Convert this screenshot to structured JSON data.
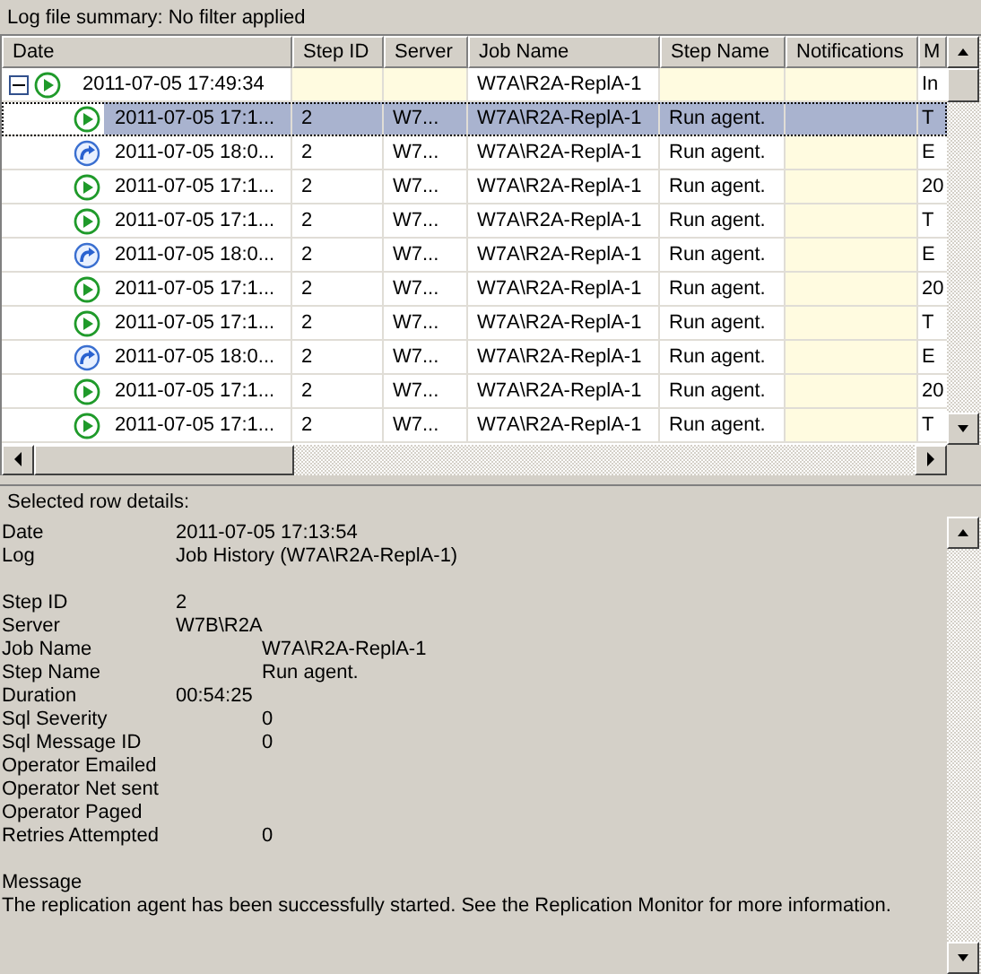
{
  "summary_label": "Log file summary: No filter applied",
  "grid": {
    "columns": [
      "Date",
      "Step ID",
      "Server",
      "Job Name",
      "Step Name",
      "Notifications",
      "M"
    ],
    "rows": [
      {
        "kind": "play",
        "date": "2011-07-05 17:49:34",
        "job_name": "W7A\\R2A-ReplA-1",
        "message": "In",
        "expanded": true,
        "selected": false,
        "children": [
          {
            "kind": "play",
            "date": "2011-07-05 17:1...",
            "step_id": "2",
            "server": "W7...",
            "job_name": "W7A\\R2A-ReplA-1",
            "step_name": "Run agent.",
            "message": "T",
            "selected": true
          },
          {
            "kind": "retry",
            "date": "2011-07-05 18:0...",
            "step_id": "2",
            "server": "W7...",
            "job_name": "W7A\\R2A-ReplA-1",
            "step_name": "Run agent.",
            "message": "E",
            "selected": false
          },
          {
            "kind": "play",
            "date": "2011-07-05 17:1...",
            "step_id": "2",
            "server": "W7...",
            "job_name": "W7A\\R2A-ReplA-1",
            "step_name": "Run agent.",
            "message": "20",
            "selected": false
          },
          {
            "kind": "play",
            "date": "2011-07-05 17:1...",
            "step_id": "2",
            "server": "W7...",
            "job_name": "W7A\\R2A-ReplA-1",
            "step_name": "Run agent.",
            "message": "T",
            "selected": false
          },
          {
            "kind": "retry",
            "date": "2011-07-05 18:0...",
            "step_id": "2",
            "server": "W7...",
            "job_name": "W7A\\R2A-ReplA-1",
            "step_name": "Run agent.",
            "message": "E",
            "selected": false
          },
          {
            "kind": "play",
            "date": "2011-07-05 17:1...",
            "step_id": "2",
            "server": "W7...",
            "job_name": "W7A\\R2A-ReplA-1",
            "step_name": "Run agent.",
            "message": "20",
            "selected": false
          },
          {
            "kind": "play",
            "date": "2011-07-05 17:1...",
            "step_id": "2",
            "server": "W7...",
            "job_name": "W7A\\R2A-ReplA-1",
            "step_name": "Run agent.",
            "message": "T",
            "selected": false
          },
          {
            "kind": "retry",
            "date": "2011-07-05 18:0...",
            "step_id": "2",
            "server": "W7...",
            "job_name": "W7A\\R2A-ReplA-1",
            "step_name": "Run agent.",
            "message": "E",
            "selected": false
          },
          {
            "kind": "play",
            "date": "2011-07-05 17:1...",
            "step_id": "2",
            "server": "W7...",
            "job_name": "W7A\\R2A-ReplA-1",
            "step_name": "Run agent.",
            "message": "20",
            "selected": false
          },
          {
            "kind": "play",
            "date": "2011-07-05 17:1...",
            "step_id": "2",
            "server": "W7...",
            "job_name": "W7A\\R2A-ReplA-1",
            "step_name": "Run agent.",
            "message": "T",
            "selected": false
          }
        ]
      }
    ]
  },
  "details": {
    "title": "Selected row details:",
    "groups": [
      [
        {
          "label": "Date",
          "value": "2011-07-05 17:13:54",
          "kind": "near"
        },
        {
          "label": "Log",
          "value": "Job History (W7A\\R2A-ReplA-1)",
          "kind": "near"
        }
      ],
      [
        {
          "label": "Step ID",
          "value": "2",
          "kind": "near"
        },
        {
          "label": "Server",
          "value": "W7B\\R2A",
          "kind": "near"
        },
        {
          "label": "Job Name",
          "value": "W7A\\R2A-ReplA-1",
          "kind": "far"
        },
        {
          "label": "Step Name",
          "value": "Run agent.",
          "kind": "far"
        },
        {
          "label": "Duration",
          "value": "00:54:25",
          "kind": "near"
        },
        {
          "label": "Sql Severity",
          "value": "0",
          "kind": "far"
        },
        {
          "label": "Sql Message ID",
          "value": "0",
          "kind": "far"
        },
        {
          "label": "Operator Emailed"
        },
        {
          "label": "Operator Net sent"
        },
        {
          "label": "Operator Paged"
        },
        {
          "label": "Retries Attempted",
          "value": "0",
          "kind": "far"
        }
      ]
    ],
    "message_label": "Message",
    "message": "The replication agent has been successfully started. See the Replication Monitor for more information."
  }
}
